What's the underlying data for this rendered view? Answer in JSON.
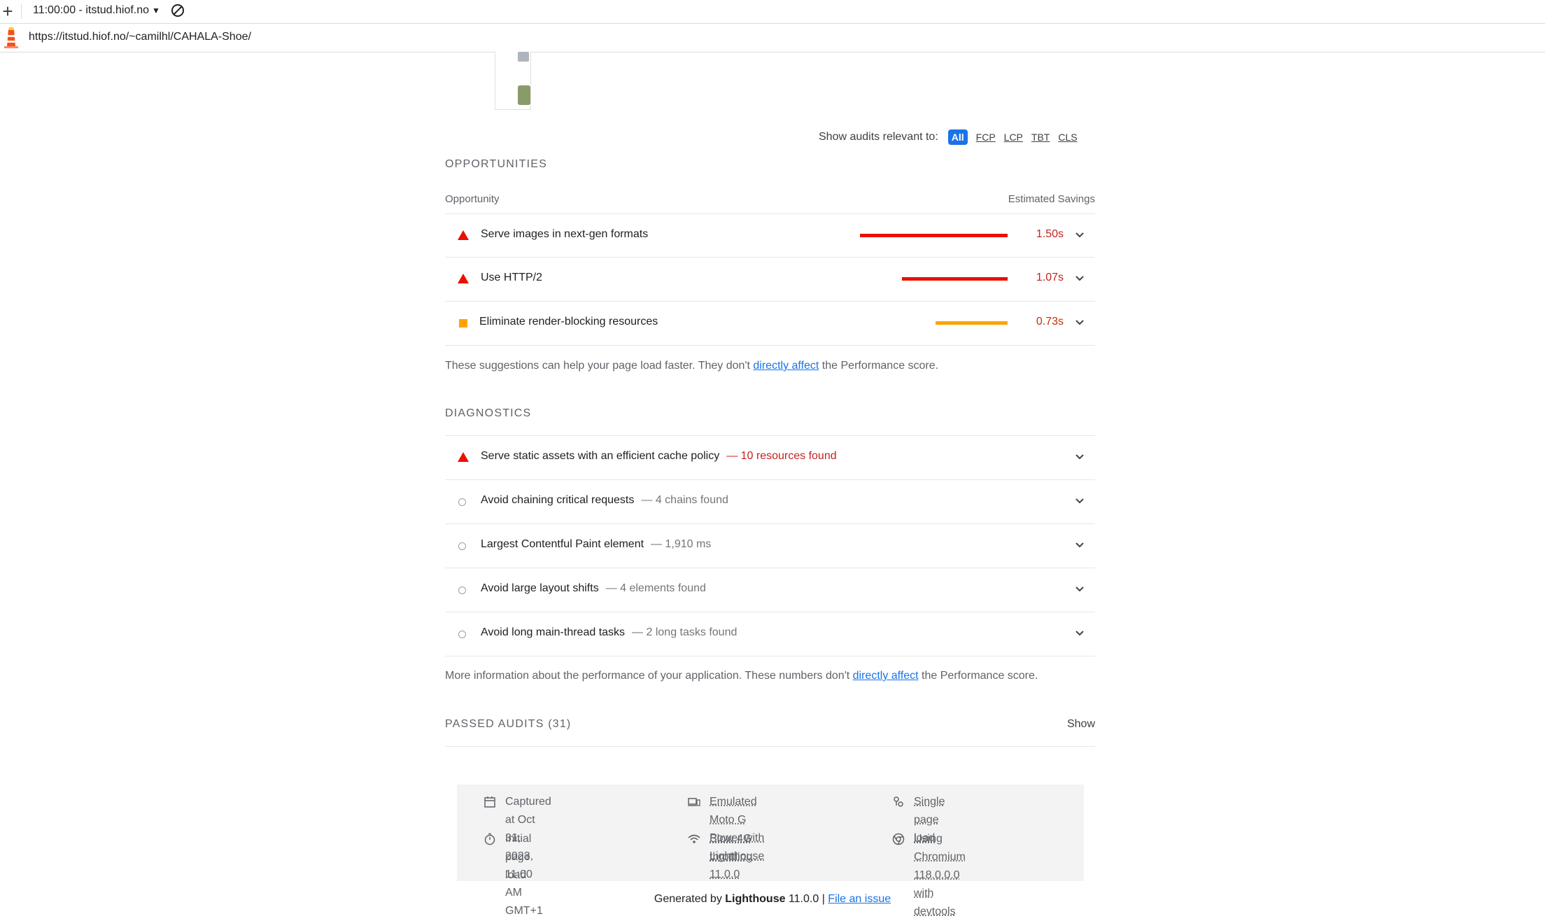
{
  "toolbar": {
    "report_title": "11:00:00 - itstud.hiof.no",
    "plus_glyph": "+",
    "caret_glyph": "▼",
    "url": "https://itstud.hiof.no/~camilhl/CAHALA-Shoe/"
  },
  "filter": {
    "label": "Show audits relevant to:",
    "chips": [
      "All",
      "FCP",
      "LCP",
      "TBT",
      "CLS"
    ]
  },
  "opportunities": {
    "title": "OPPORTUNITIES",
    "col_opportunity": "Opportunity",
    "col_savings": "Estimated Savings",
    "items": [
      {
        "title": "Serve images in next-gen formats",
        "savings": "1.50s",
        "savings_seconds": 1.5,
        "severity": "fail"
      },
      {
        "title": "Use HTTP/2",
        "savings": "1.07s",
        "savings_seconds": 1.07,
        "severity": "fail"
      },
      {
        "title": "Eliminate render-blocking resources",
        "savings": "0.73s",
        "savings_seconds": 0.73,
        "severity": "average"
      }
    ],
    "note_before": "These suggestions can help your page load faster. They don't ",
    "note_link": "directly affect",
    "note_after": " the Performance score."
  },
  "diagnostics": {
    "title": "DIAGNOSTICS",
    "items": [
      {
        "title": "Serve static assets with an efficient cache policy",
        "detail": "— 10 resources found",
        "severity": "fail"
      },
      {
        "title": "Avoid chaining critical requests",
        "detail": "— 4 chains found",
        "severity": "info"
      },
      {
        "title": "Largest Contentful Paint element",
        "detail": "— 1,910 ms",
        "severity": "info"
      },
      {
        "title": "Avoid large layout shifts",
        "detail": "— 4 elements found",
        "severity": "info"
      },
      {
        "title": "Avoid long main-thread tasks",
        "detail": "— 2 long tasks found",
        "severity": "info"
      }
    ],
    "note_before": "More information about the performance of your application. These numbers don't ",
    "note_link": "directly affect",
    "note_after": " the Performance score."
  },
  "passed": {
    "title": "PASSED AUDITS (31)",
    "show": "Show"
  },
  "environment": {
    "captured_line1": "Captured at Oct 31, 2023,",
    "captured_line2": "11:00 AM GMT+1",
    "initial_load": "Initial page load",
    "device_line1": "Emulated Moto G Power with",
    "device_line2": "Lighthouse 11.0.0",
    "throttling": "Slow 4G throttling",
    "single_load": "Single page load",
    "browser_line1": "Using Chromium 118.0.0.0 with",
    "browser_line2": "devtools"
  },
  "footer": {
    "generated_by": "Generated by ",
    "lighthouse": "Lighthouse",
    "version": " 11.0.0 | ",
    "file_issue": "File an issue"
  },
  "colors": {
    "fail": "#eb0f00",
    "average": "#ffa400",
    "link": "#1a73e8",
    "active_chip": "#1a73e8"
  }
}
